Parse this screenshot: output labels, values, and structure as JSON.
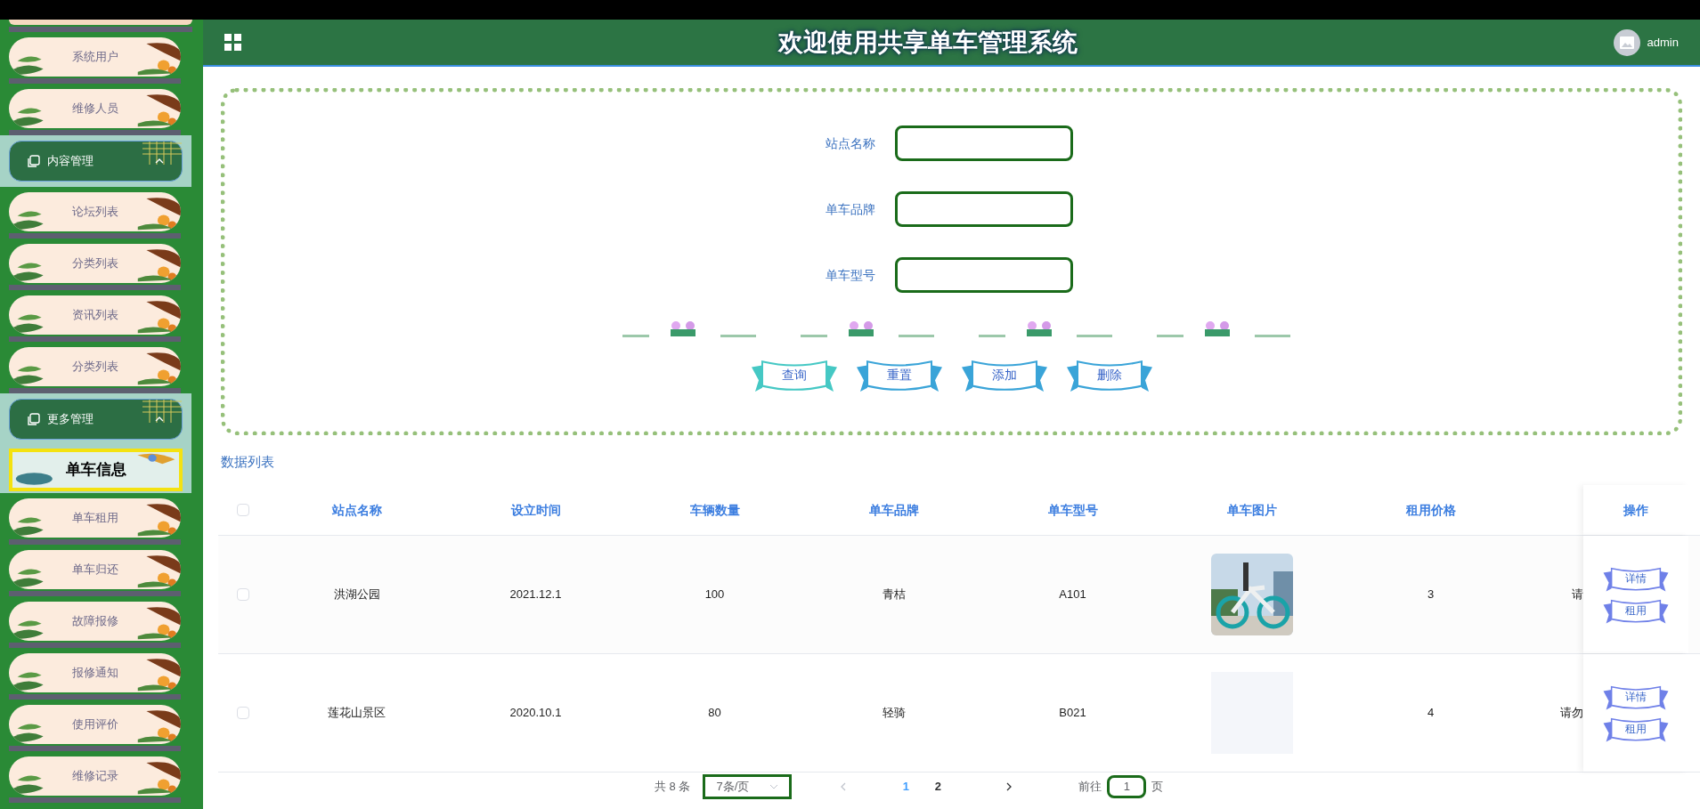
{
  "header": {
    "title": "欢迎使用共享单车管理系统",
    "user": "admin"
  },
  "sidebar": {
    "items": [
      {
        "kind": "item",
        "label": "系统用户",
        "selected": false
      },
      {
        "kind": "item",
        "label": "维修人员",
        "selected": false
      },
      {
        "kind": "group",
        "label": "内容管理",
        "expanded": true
      },
      {
        "kind": "item",
        "label": "论坛列表",
        "selected": false
      },
      {
        "kind": "item",
        "label": "分类列表",
        "selected": false
      },
      {
        "kind": "item",
        "label": "资讯列表",
        "selected": false
      },
      {
        "kind": "item",
        "label": "分类列表",
        "selected": false
      },
      {
        "kind": "group",
        "label": "更多管理",
        "expanded": true
      },
      {
        "kind": "item",
        "label": "单车信息",
        "selected": true
      },
      {
        "kind": "item",
        "label": "单车租用",
        "selected": false
      },
      {
        "kind": "item",
        "label": "单车归还",
        "selected": false
      },
      {
        "kind": "item",
        "label": "故障报修",
        "selected": false
      },
      {
        "kind": "item",
        "label": "报修通知",
        "selected": false
      },
      {
        "kind": "item",
        "label": "使用评价",
        "selected": false
      },
      {
        "kind": "item",
        "label": "维修记录",
        "selected": false
      }
    ]
  },
  "search": {
    "fields": [
      {
        "label": "站点名称"
      },
      {
        "label": "单车品牌"
      },
      {
        "label": "单车型号"
      }
    ],
    "buttons": [
      {
        "label": "查询",
        "kind": "teal"
      },
      {
        "label": "重置",
        "kind": "blue"
      },
      {
        "label": "添加",
        "kind": "blue"
      },
      {
        "label": "删除",
        "kind": "blue"
      }
    ]
  },
  "table": {
    "title": "数据列表",
    "select_all": {
      "checked": false
    },
    "columns": [
      "站点名称",
      "设立时间",
      "车辆数量",
      "单车品牌",
      "单车型号",
      "单车图片",
      "租用价格"
    ],
    "action_column": "操作",
    "rows": [
      {
        "checked": false,
        "cells": [
          "洪湖公园",
          "2021.12.1",
          "100",
          "青桔",
          "A101"
        ],
        "image": {
          "kind": "picture"
        },
        "price": "3",
        "column_9": "请",
        "actions": [
          "详情",
          "租用"
        ]
      },
      {
        "checked": false,
        "cells": [
          "莲花山景区",
          "2020.10.1",
          "80",
          "轻骑",
          "B021"
        ],
        "image": {
          "kind": "empty"
        },
        "price": "4",
        "column_9": "请勿",
        "actions": [
          "详情",
          "租用"
        ]
      }
    ]
  },
  "pagination": {
    "total": "共 8 条",
    "page_size": "7条/页",
    "pages": [
      {
        "label": "1",
        "selected": true
      },
      {
        "label": "2",
        "selected": false
      }
    ],
    "goto_label": "前往",
    "goto_value": "1",
    "goto_suffix": "页"
  }
}
